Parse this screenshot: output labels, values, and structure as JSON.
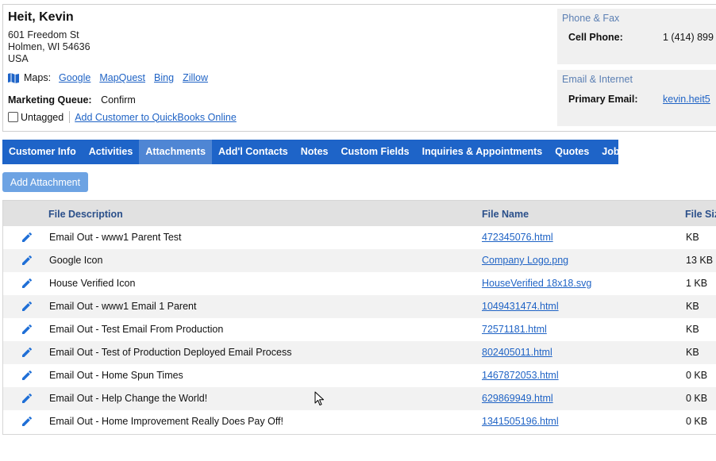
{
  "customer": {
    "name": "Heit, Kevin",
    "address": [
      "601 Freedom St",
      "Holmen, WI 54636",
      "USA"
    ],
    "maps_label": "Maps:",
    "map_links": [
      "Google",
      "MapQuest",
      "Bing",
      "Zillow"
    ],
    "marketing_queue_label": "Marketing Queue:",
    "marketing_queue_value": "Confirm",
    "tag_label": "Untagged",
    "quickbooks_link": "Add Customer to QuickBooks Online"
  },
  "phone_fax": {
    "title": "Phone & Fax",
    "label": "Cell Phone:",
    "value": "1 (414) 899"
  },
  "email_internet": {
    "title": "Email & Internet",
    "label": "Primary Email:",
    "value": "kevin.heit5"
  },
  "tabs": [
    {
      "label": "Customer Info",
      "active": false
    },
    {
      "label": "Activities",
      "active": false
    },
    {
      "label": "Attachments",
      "active": true
    },
    {
      "label": "Add'l Contacts",
      "active": false
    },
    {
      "label": "Notes",
      "active": false
    },
    {
      "label": "Custom Fields",
      "active": false
    },
    {
      "label": "Inquiries & Appointments",
      "active": false
    },
    {
      "label": "Quotes",
      "active": false
    },
    {
      "label": "Jobs",
      "active": false
    }
  ],
  "add_attachment_label": "Add Attachment",
  "table": {
    "headers": {
      "description": "File Description",
      "file_name": "File Name",
      "file_size": "File Size"
    },
    "rows": [
      {
        "description": "Email Out - www1 Parent Test",
        "file_name": "472345076.html",
        "file_size": "KB"
      },
      {
        "description": "Google Icon",
        "file_name": "Company Logo.png",
        "file_size": "13 KB"
      },
      {
        "description": "House Verified Icon",
        "file_name": "HouseVerified 18x18.svg",
        "file_size": "1 KB"
      },
      {
        "description": "Email Out - www1 Email 1 Parent",
        "file_name": "1049431474.html",
        "file_size": "KB"
      },
      {
        "description": "Email Out - Test Email From Production",
        "file_name": "72571181.html",
        "file_size": "KB"
      },
      {
        "description": "Email Out - Test of Production Deployed Email Process",
        "file_name": "802405011.html",
        "file_size": "KB"
      },
      {
        "description": "Email Out - Home Spun Times",
        "file_name": "1467872053.html",
        "file_size": "0 KB"
      },
      {
        "description": "Email Out - Help Change the World!",
        "file_name": "629869949.html",
        "file_size": "0 KB"
      },
      {
        "description": "Email Out - Home Improvement Really Does Pay Off!",
        "file_name": "1341505196.html",
        "file_size": "0 KB"
      }
    ]
  },
  "icons": {
    "map": "map-icon",
    "edit": "pencil-icon",
    "cursor": "mouse-pointer-icon"
  },
  "colors": {
    "tab_bar": "#1e64c8",
    "tab_active": "#4f86d4",
    "link": "#1f63c5",
    "button": "#6da3e3"
  }
}
